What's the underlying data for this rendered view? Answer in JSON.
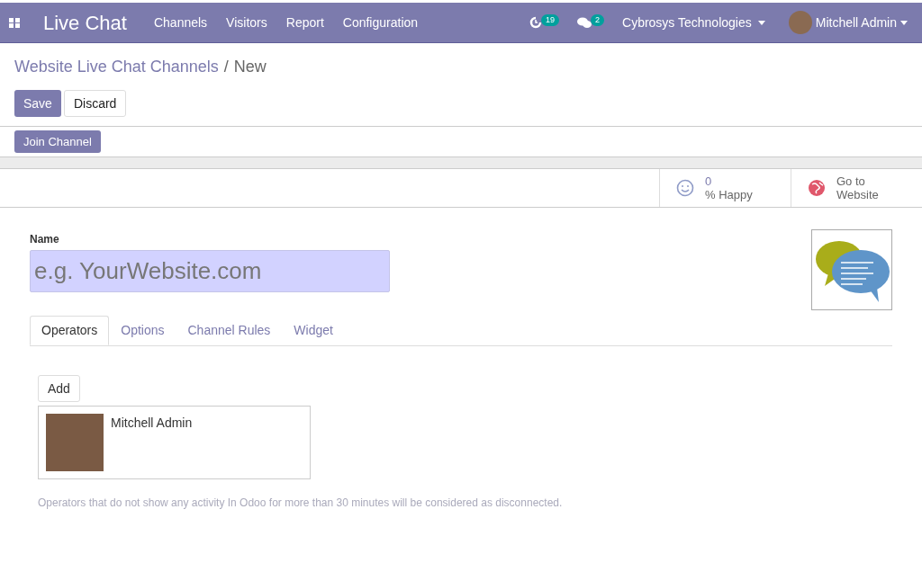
{
  "navbar": {
    "app_name": "Live Chat",
    "menu": [
      "Channels",
      "Visitors",
      "Report",
      "Configuration"
    ],
    "activity_count": "19",
    "message_count": "2",
    "company": "Cybrosys Technologies",
    "user": "Mitchell Admin"
  },
  "breadcrumb": {
    "parent": "Website Live Chat Channels",
    "separator": "/",
    "current": "New"
  },
  "actions": [
    {
      "label": "Save",
      "kind": "primary"
    },
    {
      "label": "Discard",
      "kind": "secondary"
    }
  ],
  "header_buttons": [
    "Join Channel"
  ],
  "stat_buttons": [
    {
      "kind": "happy",
      "value": "0",
      "label": "% Happy"
    },
    {
      "kind": "website",
      "value": "Go to",
      "label": "Website"
    }
  ],
  "form": {
    "name_label": "Name",
    "name_placeholder": "e.g. YourWebsite.com",
    "tabs": [
      {
        "label": "Operators",
        "selected": true
      },
      {
        "label": "Options",
        "selected": false
      },
      {
        "label": "Channel Rules",
        "selected": false
      },
      {
        "label": "Widget",
        "selected": false
      }
    ],
    "add_button": "Add",
    "operators": [
      {
        "name": "Mitchell Admin"
      }
    ],
    "help_text": "Operators that do not show any activity In Odoo for more than 30 minutes will be considered as disconnected."
  }
}
